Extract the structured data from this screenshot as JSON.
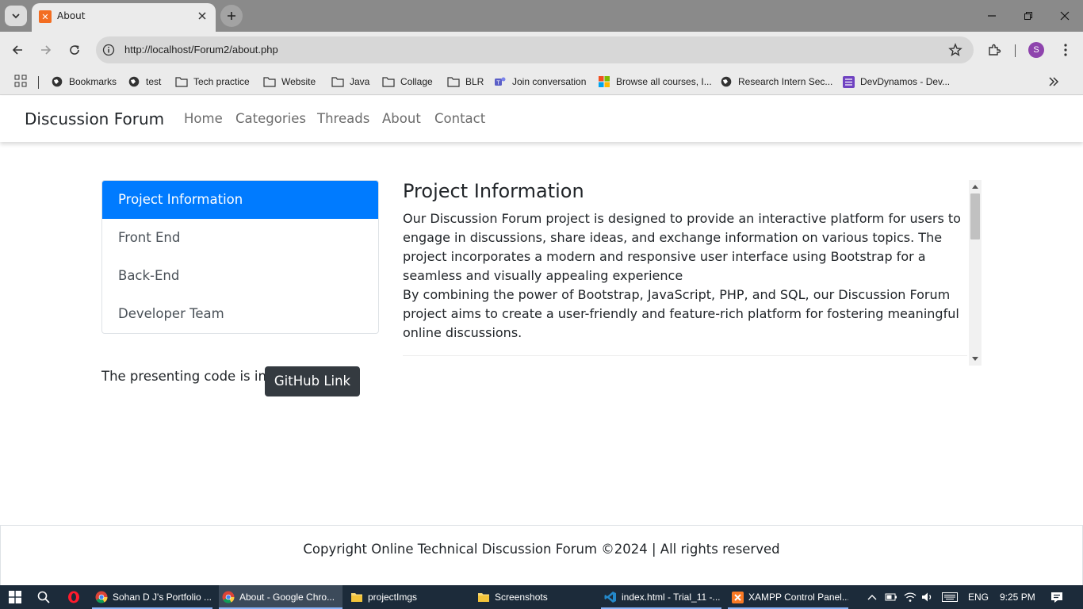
{
  "browser": {
    "tab_title": "About",
    "url": "http://localhost/Forum2/about.php",
    "profile_initial": "S",
    "bookmarks": [
      {
        "label": "Bookmarks",
        "icon": "globe-icon"
      },
      {
        "label": "test",
        "icon": "globe-icon"
      },
      {
        "label": "Tech practice",
        "icon": "folder-icon"
      },
      {
        "label": "Website",
        "icon": "folder-icon"
      },
      {
        "label": "Java",
        "icon": "folder-icon"
      },
      {
        "label": "Collage",
        "icon": "folder-icon"
      },
      {
        "label": "BLR",
        "icon": "folder-icon"
      },
      {
        "label": "Join conversation",
        "icon": "teams-icon"
      },
      {
        "label": "Browse all courses, I...",
        "icon": "microsoft-icon"
      },
      {
        "label": "Research Intern Sec...",
        "icon": "globe-icon"
      },
      {
        "label": "DevDynamos - Dev...",
        "icon": "purple-app-icon"
      }
    ]
  },
  "site": {
    "brand": "Discussion Forum",
    "nav": [
      "Home",
      "Categories",
      "Threads",
      "About",
      "Contact"
    ],
    "sidebar": [
      {
        "label": "Project Information",
        "active": true
      },
      {
        "label": "Front End",
        "active": false
      },
      {
        "label": "Back-End",
        "active": false
      },
      {
        "label": "Developer Team",
        "active": false
      }
    ],
    "info": {
      "title": "Project Information",
      "paragraph1": "Our Discussion Forum project is designed to provide an interactive platform for users to engage in discussions, share ideas, and exchange information on various topics. The project incorporates a modern and responsive user interface using Bootstrap for a seamless and visually appealing experience",
      "paragraph2": "By combining the power of Bootstrap, JavaScript, PHP, and SQL, our Discussion Forum project aims to create a user-friendly and feature-rich platform for fostering meaningful online discussions."
    },
    "presenting_text": "The presenting code is in",
    "github_button": "GitHub Link",
    "footer": "Copyright Online Technical Discussion Forum ©2024 | All rights reserved"
  },
  "taskbar": {
    "tasks": [
      {
        "label": "Sohan D J's Portfolio ...",
        "icon": "chrome-icon"
      },
      {
        "label": "About - Google Chro...",
        "icon": "chrome-icon"
      },
      {
        "label": "projectImgs",
        "icon": "folder-icon"
      },
      {
        "label": "Screenshots",
        "icon": "folder-icon"
      },
      {
        "label": "index.html - Trial_11 -...",
        "icon": "vscode-icon"
      },
      {
        "label": "XAMPP Control Panel...",
        "icon": "xampp-icon"
      }
    ],
    "language": "ENG",
    "time": "9:25 PM"
  },
  "colors": {
    "active_blue": "#007bff",
    "dark_button": "#343a40",
    "taskbar_bg": "#1c2b3a"
  }
}
